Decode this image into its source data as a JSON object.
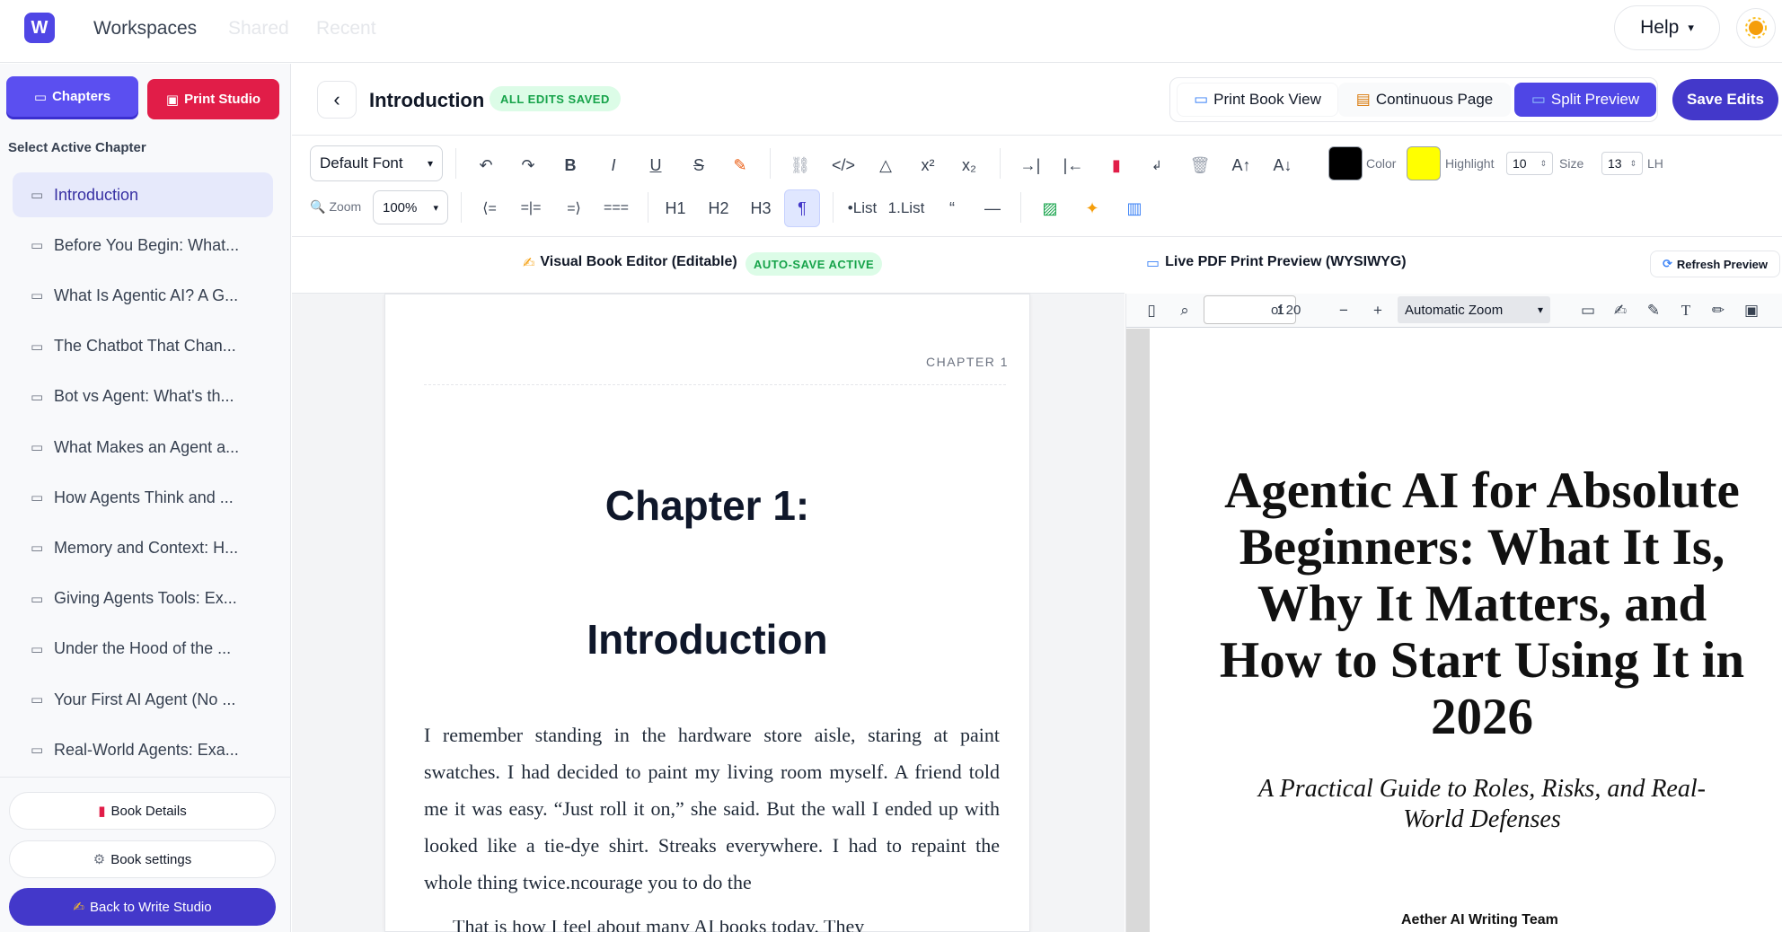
{
  "topbar": {
    "logo": "W",
    "nav": [
      "Workspaces",
      "Shared",
      "Recent"
    ],
    "help": "Help",
    "help_caret": "▾",
    "avatar_icon": "sun-icon"
  },
  "sidebar": {
    "tab_chapters": "Chapters",
    "tab_print": "Print Studio",
    "select_label": "Select Active Chapter",
    "chapters": [
      "Introduction",
      "Before You Begin: What...",
      "What Is Agentic AI? A G...",
      "The Chatbot That Chan...",
      "Bot vs Agent: What's th...",
      "What Makes an Agent a...",
      "How Agents Think and ...",
      "Memory and Context: H...",
      "Giving Agents Tools: Ex...",
      "Under the Hood of the ...",
      "Your First AI Agent (No ...",
      "Real-World Agents: Exa..."
    ],
    "book_details": "Book Details",
    "book_settings": "Book settings",
    "back_studio": "Back to Write Studio"
  },
  "header": {
    "title": "Introduction",
    "status": "ALL EDITS SAVED",
    "views": [
      "Print Book View",
      "Continuous Page",
      "Split Preview"
    ],
    "save": "Save Edits"
  },
  "toolbar": {
    "font": "Default Font",
    "zoom_label": "Zoom",
    "zoom": "100%",
    "buttons": {
      "undo": "↶",
      "redo": "↷",
      "bold": "B",
      "italic": "I",
      "underline": "U",
      "strike": "S",
      "code": "</>",
      "sup": "x²",
      "sub": "x₂",
      "h1": "H1",
      "h2": "H2",
      "h3": "H3",
      "para": "¶",
      "bullet": "•List",
      "numbered": "1.List",
      "quote": "“",
      "hr": "—",
      "align_left": "⟨=",
      "align_center": "=|=",
      "align_right": "=⟩",
      "justify": "===",
      "grow": "A↑",
      "shrink": "A↓"
    },
    "color_label": "Color",
    "highlight_label": "Highlight",
    "highlight_val": "10",
    "size_label": "Size",
    "size_val": "13",
    "lh_label": "LH",
    "colors": {
      "text": "#000000",
      "highlight": "#ffff00"
    }
  },
  "editor": {
    "header": "Visual Book Editor (Editable)",
    "autosave": "AUTO-SAVE ACTIVE",
    "chapter_label": "CHAPTER 1",
    "heading1": "Chapter 1:",
    "heading2": "Introduction",
    "para1": "I remember standing in the hardware store aisle, staring at paint swatches. I had decided to paint my living room myself. A friend told me it was easy. “Just roll it on,” she said. But the wall I ended up with looked like a tie-dye shirt. Streaks everywhere. I had to repaint the whole thing twice.ncourage you to do the",
    "para2": "That is how I feel about many AI books today. They"
  },
  "preview": {
    "header": "Live PDF Print Preview (WYSIWYG)",
    "refresh": "Refresh Preview",
    "page": "1",
    "of": "of 20",
    "zoom": "Automatic Zoom",
    "title": "Agentic AI for Absolute Beginners: What It Is, Why It Matters, and How to Start Using It in 2026",
    "subtitle": "A Practical Guide to Roles, Risks, and Real-World Defenses",
    "author": "Aether AI Writing Team"
  },
  "theme": {
    "accent": "#4338ca",
    "pink": "#e11d48",
    "success": "#16a34a"
  }
}
